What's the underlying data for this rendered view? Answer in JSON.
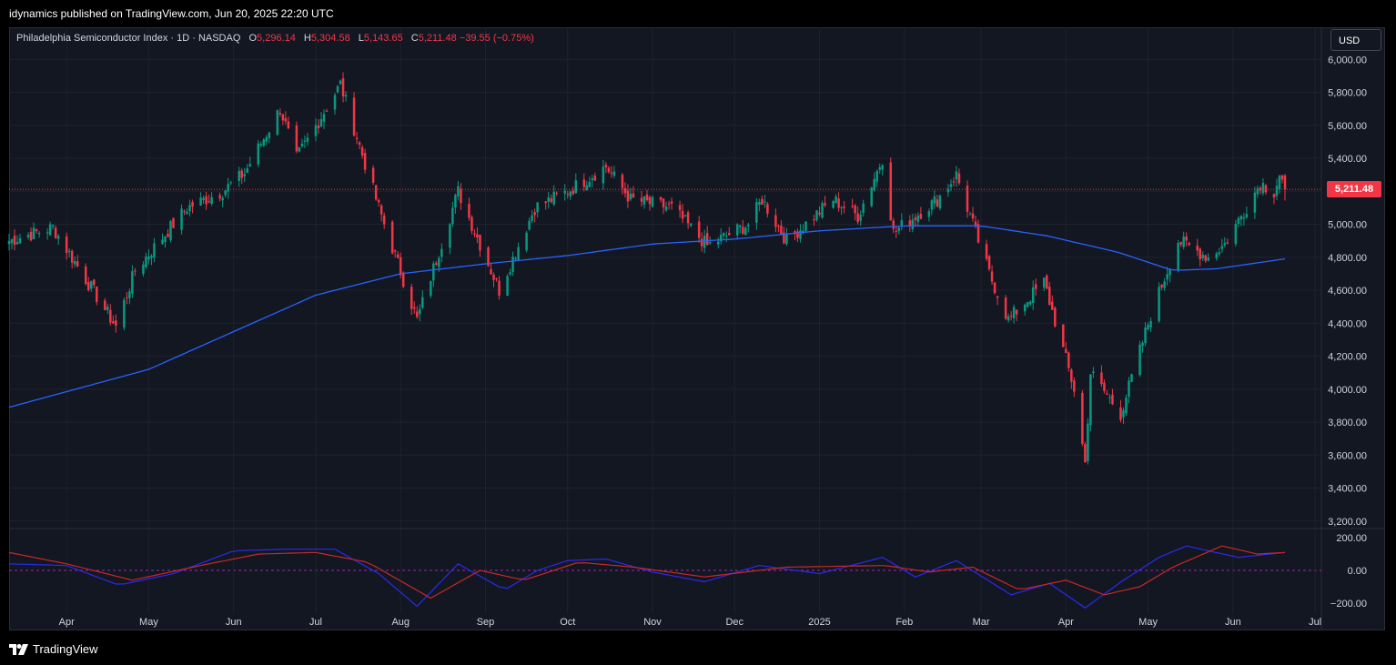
{
  "header": {
    "publisher_text": "idynamics published on TradingView.com, Jun 20, 2025 22:20 UTC"
  },
  "legend": {
    "symbol": "Philadelphia Semiconductor Index · 1D · NASDAQ",
    "open_label": "O",
    "open": "5,296.14",
    "high_label": "H",
    "high": "5,304.58",
    "low_label": "L",
    "low": "5,143.65",
    "close_label": "C",
    "close": "5,211.48",
    "change": "−39.55 (−0.75%)"
  },
  "currency": "USD",
  "last_price_badge": "5,211.48",
  "footer": {
    "brand": "TradingView"
  },
  "colors": {
    "up": "#089981",
    "down": "#f23645",
    "ma": "#2962ff",
    "osc_fast": "#2a2aee",
    "osc_slow": "#c62828",
    "background": "#131722"
  },
  "chart_data": {
    "type": "candlestick",
    "price_axis": {
      "ticks": [
        "6,000.00",
        "5,800.00",
        "5,600.00",
        "5,400.00",
        "5,200.00",
        "5,000.00",
        "4,800.00",
        "4,600.00",
        "4,400.00",
        "4,200.00",
        "4,000.00",
        "3,800.00",
        "3,600.00",
        "3,400.00",
        "3,200.00"
      ],
      "range": [
        3160,
        6040
      ]
    },
    "oscillator_axis": {
      "ticks": [
        "200.00",
        "0.00",
        "−200.00"
      ],
      "range": [
        -240,
        240
      ]
    },
    "time_axis": [
      "Apr",
      "May",
      "Jun",
      "Jul",
      "Aug",
      "Sep",
      "Oct",
      "Nov",
      "Dec",
      "2025",
      "Feb",
      "Mar",
      "Apr",
      "May",
      "Jun",
      "Jul"
    ],
    "price_anchors": [
      [
        "2024-03-11",
        4900
      ],
      [
        "2024-03-27",
        4980
      ],
      [
        "2024-04-19",
        4380
      ],
      [
        "2024-04-26",
        4720
      ],
      [
        "2024-05-15",
        5100
      ],
      [
        "2024-05-28",
        5200
      ],
      [
        "2024-06-05",
        5310
      ],
      [
        "2024-06-18",
        5700
      ],
      [
        "2024-06-24",
        5400
      ],
      [
        "2024-07-10",
        5850
      ],
      [
        "2024-07-24",
        5100
      ],
      [
        "2024-08-07",
        4420
      ],
      [
        "2024-08-22",
        5200
      ],
      [
        "2024-09-06",
        4600
      ],
      [
        "2024-09-19",
        5100
      ],
      [
        "2024-10-01",
        5200
      ],
      [
        "2024-10-15",
        5350
      ],
      [
        "2024-10-24",
        5150
      ],
      [
        "2024-11-08",
        5100
      ],
      [
        "2024-11-21",
        4870
      ],
      [
        "2024-12-06",
        5000
      ],
      [
        "2024-12-11",
        5150
      ],
      [
        "2024-12-20",
        4900
      ],
      [
        "2025-01-06",
        5150
      ],
      [
        "2025-01-15",
        5050
      ],
      [
        "2025-01-24",
        5400
      ],
      [
        "2025-01-28",
        4950
      ],
      [
        "2025-02-13",
        5150
      ],
      [
        "2025-02-20",
        5300
      ],
      [
        "2025-03-04",
        4700
      ],
      [
        "2025-03-11",
        4420
      ],
      [
        "2025-03-24",
        4650
      ],
      [
        "2025-04-04",
        4000
      ],
      [
        "2025-04-08",
        3550
      ],
      [
        "2025-04-10",
        4100
      ],
      [
        "2025-04-21",
        3850
      ],
      [
        "2025-05-02",
        4450
      ],
      [
        "2025-05-12",
        4900
      ],
      [
        "2025-05-23",
        4800
      ],
      [
        "2025-05-29",
        4880
      ],
      [
        "2025-06-11",
        5250
      ],
      [
        "2025-06-16",
        5200
      ],
      [
        "2025-06-18",
        5300
      ],
      [
        "2025-06-20",
        5211.48
      ]
    ],
    "moving_average_anchors": [
      [
        "2024-03-11",
        3890
      ],
      [
        "2024-05-01",
        4120
      ],
      [
        "2024-07-01",
        4570
      ],
      [
        "2024-08-01",
        4700
      ],
      [
        "2024-09-01",
        4760
      ],
      [
        "2024-10-01",
        4810
      ],
      [
        "2024-11-01",
        4880
      ],
      [
        "2024-12-01",
        4910
      ],
      [
        "2025-01-01",
        4960
      ],
      [
        "2025-02-01",
        4990
      ],
      [
        "2025-03-01",
        4990
      ],
      [
        "2025-03-25",
        4930
      ],
      [
        "2025-04-20",
        4830
      ],
      [
        "2025-05-10",
        4720
      ],
      [
        "2025-05-26",
        4730
      ],
      [
        "2025-06-20",
        4790
      ]
    ],
    "oscillator_fast_anchors": [
      [
        "2024-03-11",
        40
      ],
      [
        "2024-04-01",
        30
      ],
      [
        "2024-04-20",
        -90
      ],
      [
        "2024-05-10",
        -20
      ],
      [
        "2024-06-01",
        120
      ],
      [
        "2024-06-20",
        130
      ],
      [
        "2024-07-08",
        130
      ],
      [
        "2024-07-24",
        -20
      ],
      [
        "2024-08-07",
        -220
      ],
      [
        "2024-08-22",
        40
      ],
      [
        "2024-09-08",
        -120
      ],
      [
        "2024-09-20",
        0
      ],
      [
        "2024-10-01",
        60
      ],
      [
        "2024-10-15",
        70
      ],
      [
        "2024-11-01",
        -10
      ],
      [
        "2024-11-20",
        -70
      ],
      [
        "2024-12-10",
        30
      ],
      [
        "2025-01-01",
        -20
      ],
      [
        "2025-01-24",
        80
      ],
      [
        "2025-02-05",
        -40
      ],
      [
        "2025-02-20",
        60
      ],
      [
        "2025-03-12",
        -150
      ],
      [
        "2025-03-26",
        -80
      ],
      [
        "2025-04-08",
        -230
      ],
      [
        "2025-04-22",
        -60
      ],
      [
        "2025-05-05",
        80
      ],
      [
        "2025-05-15",
        150
      ],
      [
        "2025-05-23",
        120
      ],
      [
        "2025-06-03",
        80
      ],
      [
        "2025-06-20",
        110
      ]
    ],
    "oscillator_slow_anchors": [
      [
        "2024-03-11",
        110
      ],
      [
        "2024-04-01",
        40
      ],
      [
        "2024-04-25",
        -60
      ],
      [
        "2024-05-20",
        30
      ],
      [
        "2024-06-10",
        100
      ],
      [
        "2024-07-01",
        110
      ],
      [
        "2024-07-20",
        50
      ],
      [
        "2024-08-12",
        -170
      ],
      [
        "2024-08-30",
        0
      ],
      [
        "2024-09-15",
        -60
      ],
      [
        "2024-10-05",
        50
      ],
      [
        "2024-10-25",
        20
      ],
      [
        "2024-11-20",
        -40
      ],
      [
        "2024-12-20",
        20
      ],
      [
        "2025-01-25",
        30
      ],
      [
        "2025-02-10",
        -10
      ],
      [
        "2025-02-26",
        20
      ],
      [
        "2025-03-15",
        -120
      ],
      [
        "2025-04-01",
        -60
      ],
      [
        "2025-04-15",
        -150
      ],
      [
        "2025-04-28",
        -100
      ],
      [
        "2025-05-10",
        20
      ],
      [
        "2025-05-28",
        150
      ],
      [
        "2025-06-10",
        100
      ],
      [
        "2025-06-20",
        110
      ]
    ]
  }
}
